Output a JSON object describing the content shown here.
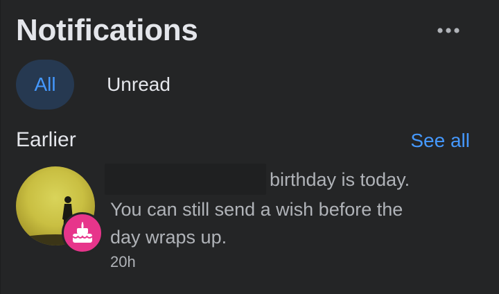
{
  "header": {
    "title": "Notifications",
    "more_icon": "more-horizontal-icon"
  },
  "tabs": [
    {
      "label": "All",
      "active": true
    },
    {
      "label": "Unread",
      "active": false
    }
  ],
  "section": {
    "label": "Earlier",
    "see_all": "See all"
  },
  "notifications": [
    {
      "text_line1": "birthday is today.",
      "text_rest": "You can still send a wish before the day wraps up.",
      "time": "20h",
      "badge_icon": "birthday-cake-icon",
      "badge_color": "#e7358b"
    }
  ],
  "colors": {
    "background": "#242526",
    "accent": "#4599ff",
    "active_tab_bg": "#263951",
    "primary_text": "#e4e6eb",
    "secondary_text": "#b0b3b8"
  }
}
